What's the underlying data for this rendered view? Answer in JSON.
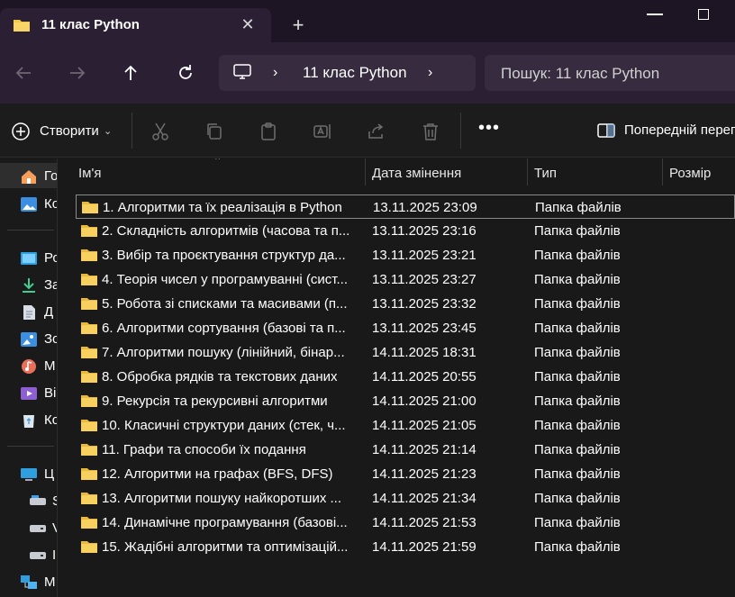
{
  "tab": {
    "title": "11 клас Python",
    "close": "✕",
    "new": "+"
  },
  "address": {
    "crumb": "11 клас Python",
    "sep": "›"
  },
  "search": {
    "placeholder": "Пошук: 11 клас Python"
  },
  "toolbar": {
    "create_label": "Створити",
    "more": "•••",
    "preview_label": "Попередній перег"
  },
  "sidebar": {
    "items": [
      {
        "label": "Го",
        "icon": "home-icon"
      },
      {
        "label": "Ко",
        "icon": "gallery-icon"
      },
      {
        "label": "Ро",
        "icon": "desktop-icon"
      },
      {
        "label": "За",
        "icon": "download-icon"
      },
      {
        "label": "Д",
        "icon": "document-icon"
      },
      {
        "label": "Зо",
        "icon": "pictures-icon"
      },
      {
        "label": "М",
        "icon": "music-icon"
      },
      {
        "label": "Ві",
        "icon": "video-icon"
      },
      {
        "label": "Ко",
        "icon": "recycle-bin-icon"
      },
      {
        "label": "Ц",
        "icon": "this-pc-icon"
      },
      {
        "label": "S",
        "icon": "drive-icon"
      },
      {
        "label": "V",
        "icon": "drive-icon"
      },
      {
        "label": "I",
        "icon": "drive-icon"
      },
      {
        "label": "М",
        "icon": "network-icon"
      }
    ]
  },
  "columns": {
    "name": "Ім'я",
    "date": "Дата змінення",
    "type": "Тип",
    "size": "Розмір"
  },
  "files": [
    {
      "name": "1. Алгоритми та їх реалізація в Python",
      "date": "13.11.2025 23:09",
      "type": "Папка файлів"
    },
    {
      "name": "2. Складність алгоритмів (часова та п...",
      "date": "13.11.2025 23:16",
      "type": "Папка файлів"
    },
    {
      "name": "3. Вибір та проєктування структур да...",
      "date": "13.11.2025 23:21",
      "type": "Папка файлів"
    },
    {
      "name": "4. Теорія чисел у програмуванні (сист...",
      "date": "13.11.2025 23:27",
      "type": "Папка файлів"
    },
    {
      "name": "5. Робота зі списками та масивами (п...",
      "date": "13.11.2025 23:32",
      "type": "Папка файлів"
    },
    {
      "name": "6. Алгоритми сортування (базові та п...",
      "date": "13.11.2025 23:45",
      "type": "Папка файлів"
    },
    {
      "name": "7. Алгоритми пошуку (лінійний, бінар...",
      "date": "14.11.2025 18:31",
      "type": "Папка файлів"
    },
    {
      "name": "8. Обробка рядків та текстових даних",
      "date": "14.11.2025 20:55",
      "type": "Папка файлів"
    },
    {
      "name": "9. Рекурсія та рекурсивні алгоритми",
      "date": "14.11.2025 21:00",
      "type": "Папка файлів"
    },
    {
      "name": "10. Класичні структури даних (стек, ч...",
      "date": "14.11.2025 21:05",
      "type": "Папка файлів"
    },
    {
      "name": "11. Графи та способи їх подання",
      "date": "14.11.2025 21:14",
      "type": "Папка файлів"
    },
    {
      "name": "12. Алгоритми на графах (BFS, DFS)",
      "date": "14.11.2025 21:23",
      "type": "Папка файлів"
    },
    {
      "name": "13. Алгоритми пошуку найкоротших ...",
      "date": "14.11.2025 21:34",
      "type": "Папка файлів"
    },
    {
      "name": "14. Динамічне програмування (базові...",
      "date": "14.11.2025 21:53",
      "type": "Папка файлів"
    },
    {
      "name": "15. Жадібні алгоритми та оптимізацій...",
      "date": "14.11.2025 21:59",
      "type": "Папка файлів"
    }
  ],
  "colors": {
    "folder": "#f4c84a",
    "accent": "#7ea8d8",
    "titlebar": "#1d1424",
    "addressbar": "#2a1f33"
  }
}
